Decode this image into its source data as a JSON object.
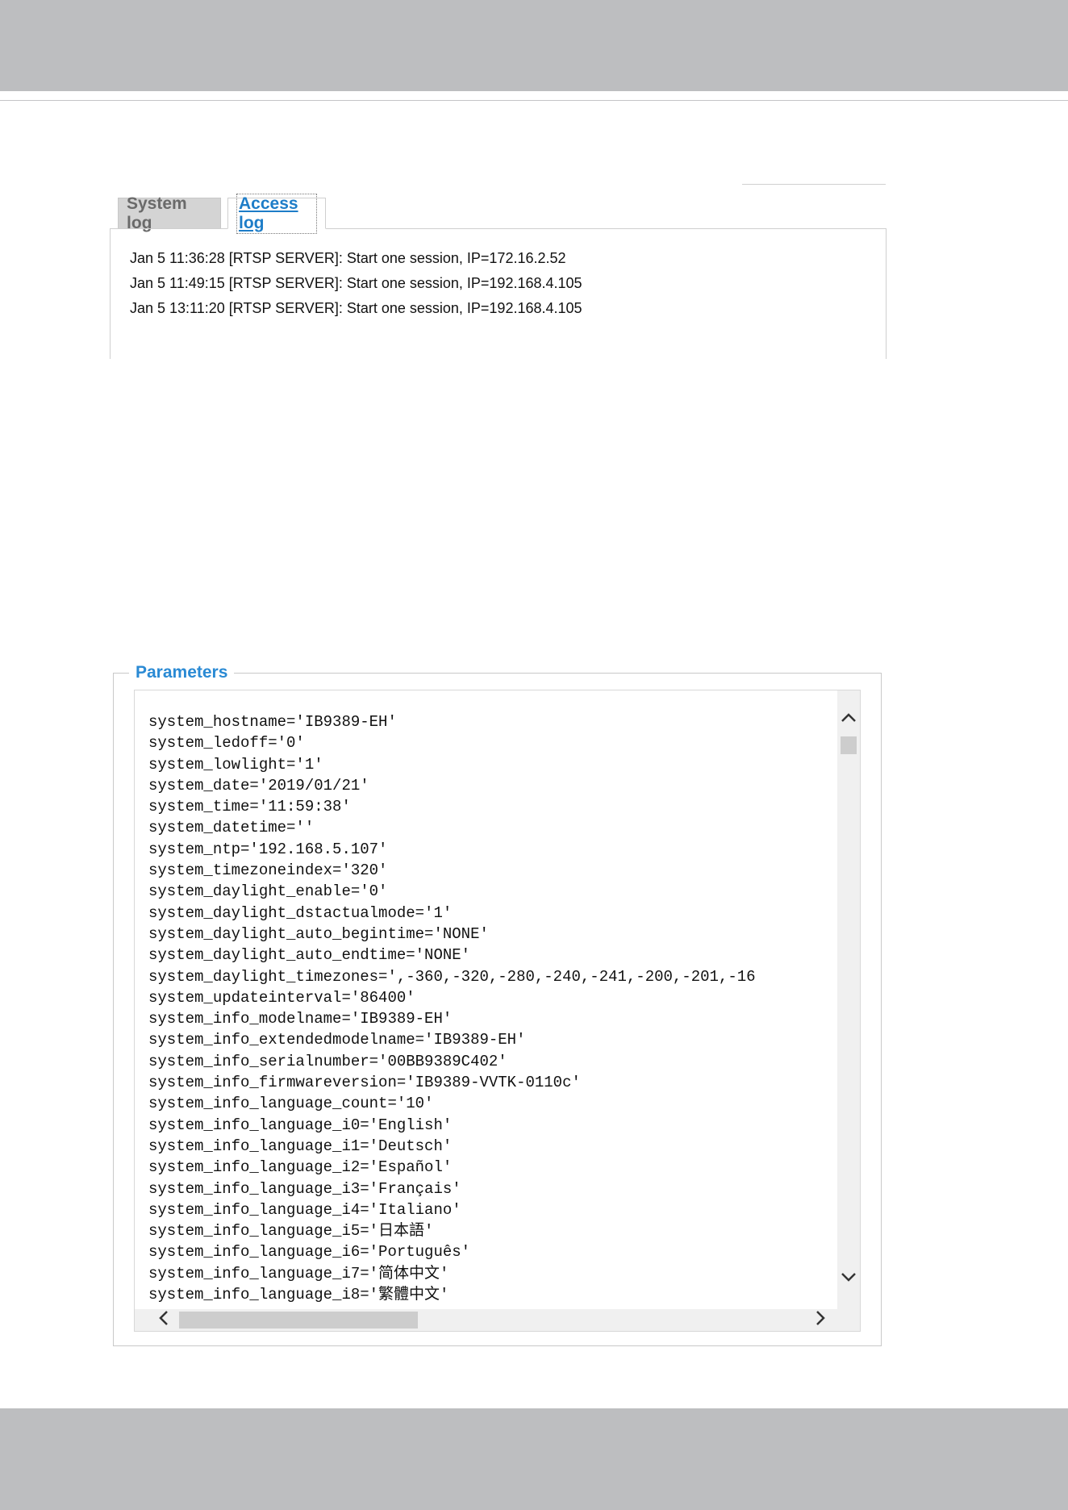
{
  "tabs": {
    "system_log": "System log",
    "access_log": "Access log",
    "active": "access_log"
  },
  "access_log": {
    "lines": [
      "Jan 5 11:36:28 [RTSP SERVER]: Start one session, IP=172.16.2.52",
      "Jan 5 11:49:15 [RTSP SERVER]: Start one session, IP=192.168.4.105",
      "Jan 5 13:11:20 [RTSP SERVER]: Start one session, IP=192.168.4.105"
    ]
  },
  "parameters": {
    "legend": "Parameters",
    "lines": [
      "system_hostname='IB9389-EH'",
      "system_ledoff='0'",
      "system_lowlight='1'",
      "system_date='2019/01/21'",
      "system_time='11:59:38'",
      "system_datetime=''",
      "system_ntp='192.168.5.107'",
      "system_timezoneindex='320'",
      "system_daylight_enable='0'",
      "system_daylight_dstactualmode='1'",
      "system_daylight_auto_begintime='NONE'",
      "system_daylight_auto_endtime='NONE'",
      "system_daylight_timezones=',-360,-320,-280,-240,-241,-200,-201,-16",
      "system_updateinterval='86400'",
      "system_info_modelname='IB9389-EH'",
      "system_info_extendedmodelname='IB9389-EH'",
      "system_info_serialnumber='00BB9389C402'",
      "system_info_firmwareversion='IB9389-VVTK-0110c'",
      "system_info_language_count='10'",
      "system_info_language_i0='English'",
      "system_info_language_i1='Deutsch'",
      "system_info_language_i2='Español'",
      "system_info_language_i3='Français'",
      "system_info_language_i4='Italiano'",
      "system_info_language_i5='日本語'",
      "system_info_language_i6='Português'",
      "system_info_language_i7='简体中文'",
      "system_info_language_i8='繁體中文'"
    ]
  },
  "icons": {
    "scroll_up": "chevron-up-icon",
    "scroll_down": "chevron-down-icon",
    "scroll_left": "chevron-left-icon",
    "scroll_right": "chevron-right-icon"
  },
  "colors": {
    "band_gray": "#bdbec0",
    "link_blue": "#1e7dc8",
    "legend_blue": "#2a8ad4"
  }
}
